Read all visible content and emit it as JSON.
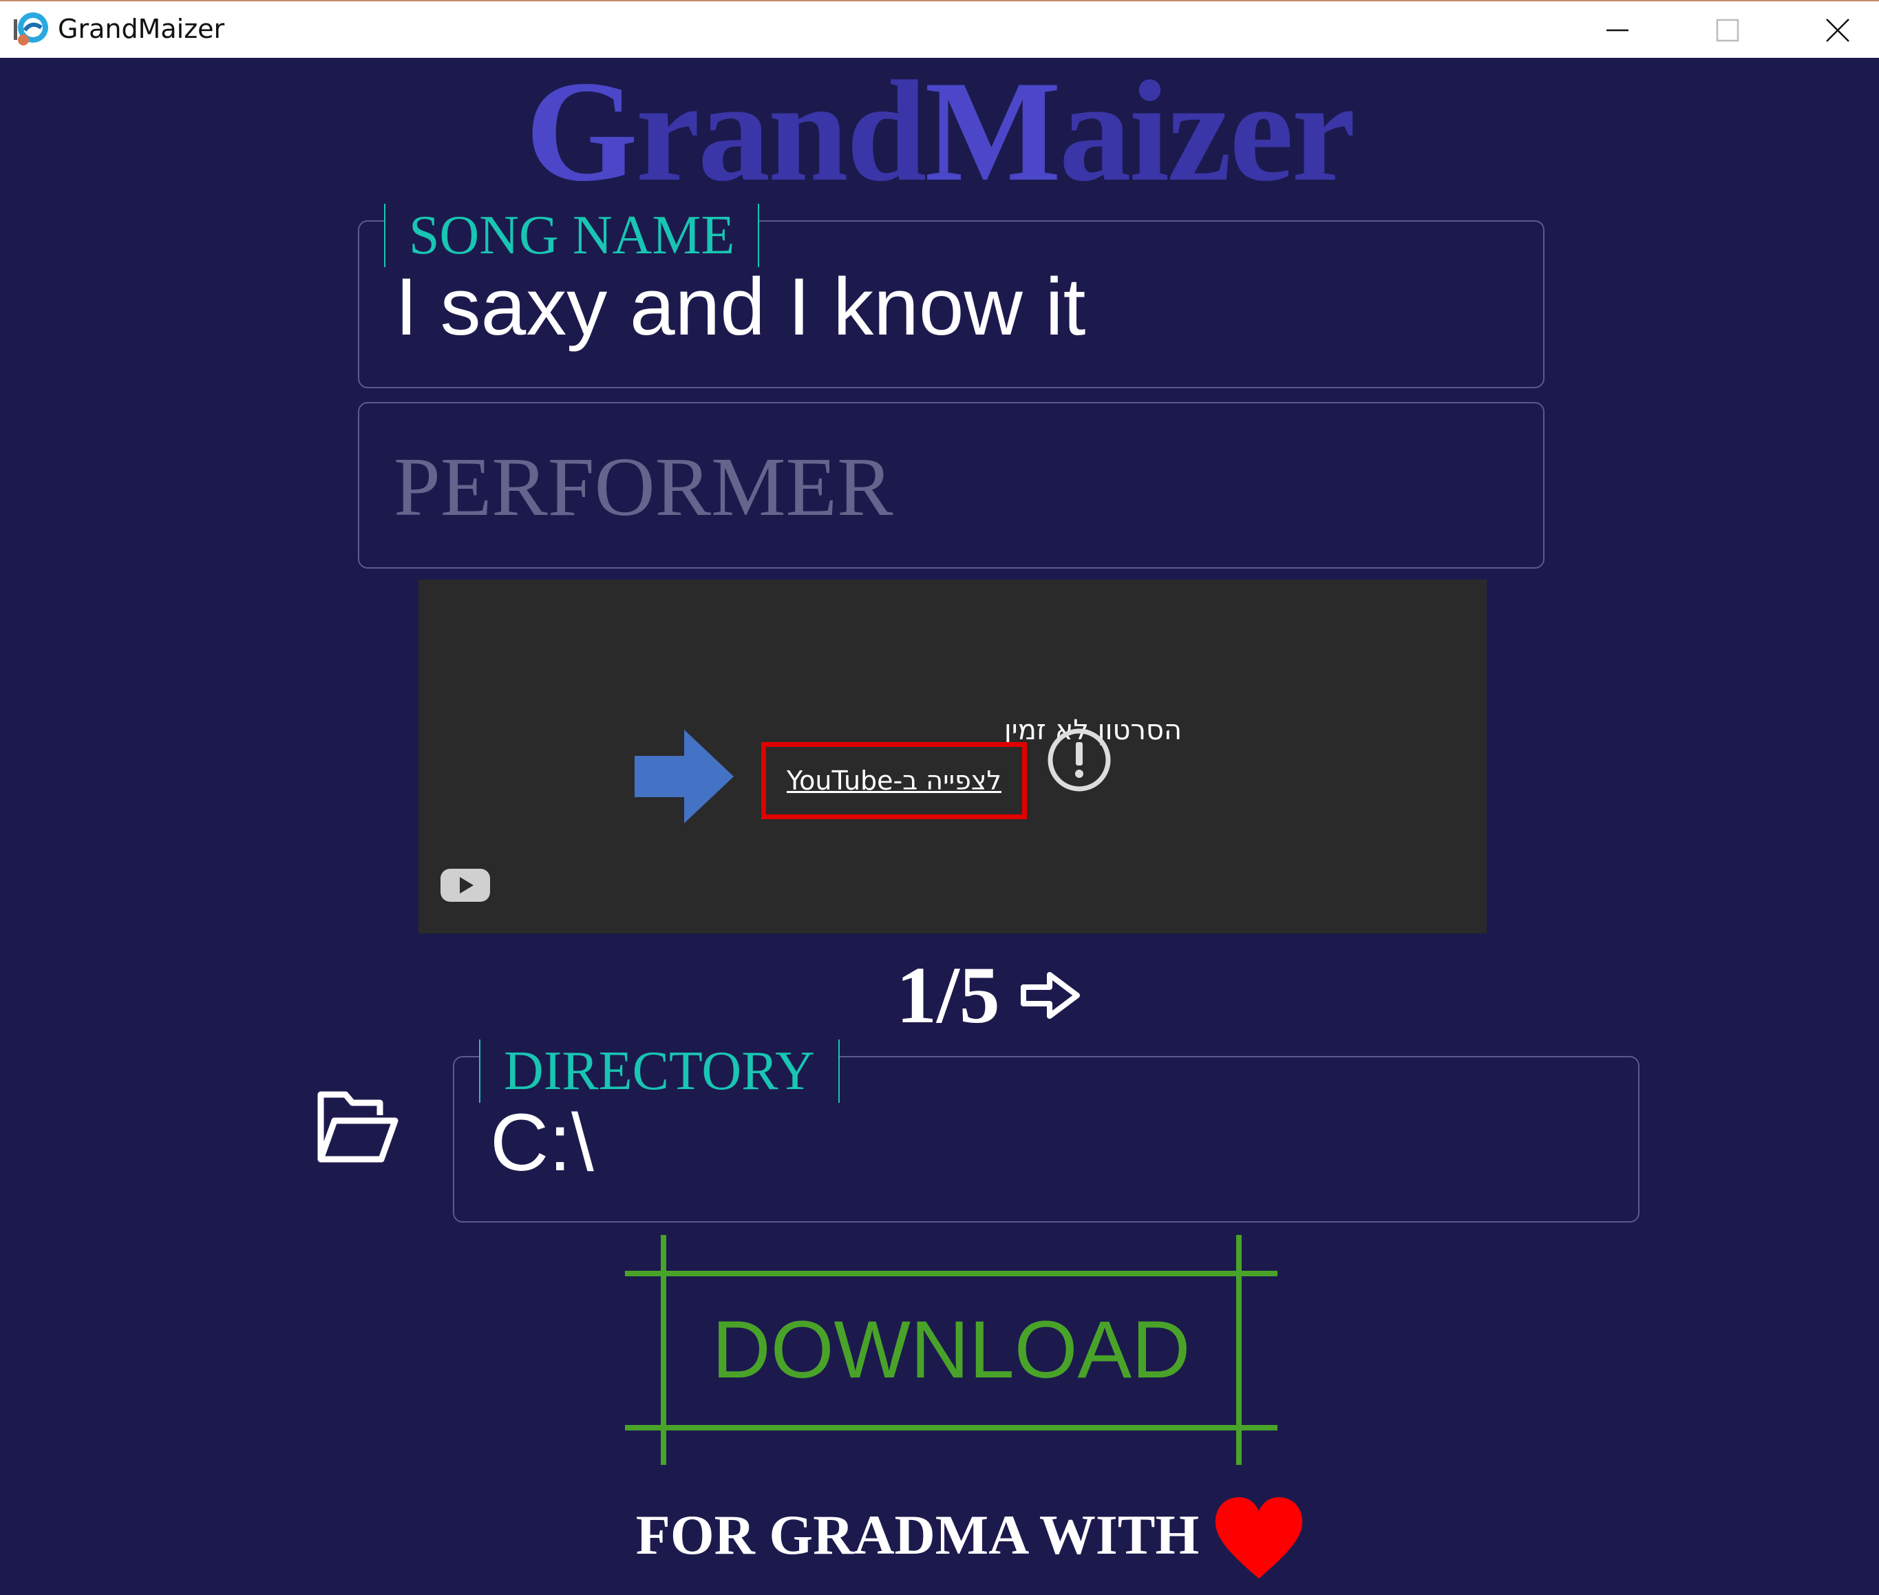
{
  "window": {
    "title": "GrandMaizer",
    "icon": "app-logo-icon",
    "controls": [
      "minimize-icon",
      "maximize-icon",
      "close-icon"
    ]
  },
  "logo": {
    "cap1": "G",
    "part1": "rand",
    "cap2": "M",
    "part2": "aizer"
  },
  "song_field": {
    "label": "SONG NAME",
    "value": "I saxy and I know it"
  },
  "performer_field": {
    "placeholder": "PERFORMER",
    "value": ""
  },
  "video": {
    "message": "הסרטון לא זמין",
    "link_text": "לצפייה ב-YouTube",
    "icons": [
      "pointer-arrow-icon",
      "alert-icon",
      "youtube-logo-icon"
    ],
    "highlight_color": "#e00000"
  },
  "pager": {
    "count": "1/5",
    "next_icon": "arrow-right-icon"
  },
  "directory_field": {
    "label": "DIRECTORY",
    "value": "C:\\",
    "icon": "folder-open-icon"
  },
  "download": {
    "label": "DOWNLOAD",
    "color": "#4aa329"
  },
  "footer": {
    "text": "FOR GRADMA WITH",
    "icon": "heart-icon"
  },
  "colors": {
    "background": "#1c1a4d",
    "accent_teal": "#19c5b3",
    "logo": "#3a36a8"
  }
}
